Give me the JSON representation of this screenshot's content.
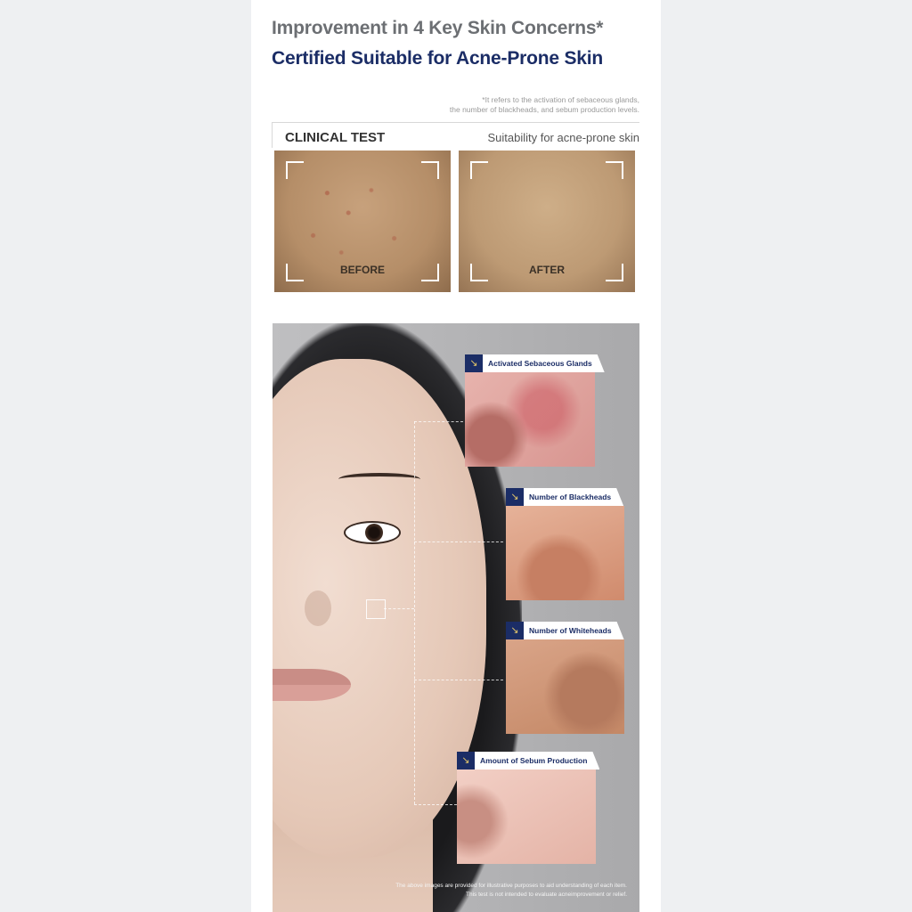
{
  "header": {
    "title": "Improvement in 4 Key Skin Concerns*",
    "subtitle": "Certified Suitable for Acne-Prone Skin",
    "footnote_line1": "*It refers to the activation of sebaceous glands,",
    "footnote_line2": "the number of blackheads, and sebum production levels."
  },
  "clinical": {
    "label": "CLINICAL TEST",
    "description": "Suitability for acne-prone skin",
    "before_label": "BEFORE",
    "after_label": "AFTER"
  },
  "concerns": [
    {
      "label": "Activated Sebaceous Glands",
      "icon": "arrow-down-right-icon"
    },
    {
      "label": "Number of Blackheads",
      "icon": "arrow-down-right-icon"
    },
    {
      "label": "Number of Whiteheads",
      "icon": "arrow-down-right-icon"
    },
    {
      "label": "Amount of Sebum Production",
      "icon": "arrow-down-right-icon"
    }
  ],
  "disclaimer": {
    "line1": "The above images are provided for illustrative purposes to aid understanding of each item.",
    "line2": "This test is not intended to evaluate acneimprovement or relief."
  },
  "colors": {
    "navy": "#1b2d66",
    "gray_text": "#6c6f73",
    "background": "#eef0f2"
  }
}
